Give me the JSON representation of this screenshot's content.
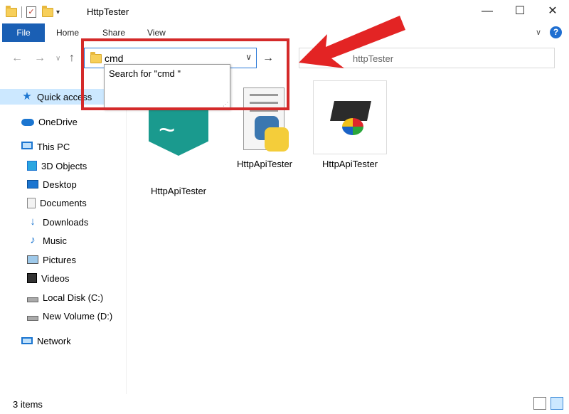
{
  "window": {
    "title": "HttpTester"
  },
  "ribbon": {
    "tabs": [
      "File",
      "Home",
      "Share",
      "View"
    ]
  },
  "address": {
    "value": "cmd",
    "search_hint": "httpTester"
  },
  "suggestion": {
    "text": "Search for \"cmd \""
  },
  "sidebar": {
    "items": [
      {
        "label": "Quick access",
        "icon": "star-icon"
      },
      {
        "label": "OneDrive",
        "icon": "cloud-icon"
      },
      {
        "label": "This PC",
        "icon": "computer-icon"
      },
      {
        "label": "3D Objects",
        "icon": "cube-icon"
      },
      {
        "label": "Desktop",
        "icon": "desktop-icon"
      },
      {
        "label": "Documents",
        "icon": "document-icon"
      },
      {
        "label": "Downloads",
        "icon": "download-icon"
      },
      {
        "label": "Music",
        "icon": "music-icon"
      },
      {
        "label": "Pictures",
        "icon": "pictures-icon"
      },
      {
        "label": "Videos",
        "icon": "videos-icon"
      },
      {
        "label": "Local Disk (C:)",
        "icon": "disk-icon"
      },
      {
        "label": "New Volume (D:)",
        "icon": "disk-icon"
      },
      {
        "label": "Network",
        "icon": "network-icon"
      }
    ]
  },
  "files": [
    {
      "name": "HttpApiTester",
      "icon": "app-icon"
    },
    {
      "name": "HttpApiTester",
      "icon": "python-icon"
    },
    {
      "name": "HttpApiTester",
      "icon": "exe-icon"
    }
  ],
  "status": {
    "items": "3 items"
  },
  "colors": {
    "accent": "#1a5fb4",
    "highlight": "#d42a2a",
    "selection": "#cce8ff"
  }
}
